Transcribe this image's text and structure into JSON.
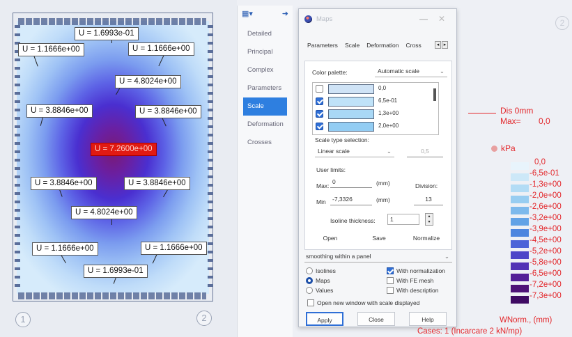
{
  "viewport": {
    "labels": [
      {
        "text": "U = 1.6993e-01"
      },
      {
        "text": "U = 1.1666e+00"
      },
      {
        "text": "U = 1.1666e+00"
      },
      {
        "text": "U = 4.8024e+00"
      },
      {
        "text": "U = 3.8846e+00"
      },
      {
        "text": "U = 3.8846e+00"
      },
      {
        "text": "U = 7.2600e+00"
      },
      {
        "text": "U = 3.8846e+00"
      },
      {
        "text": "U = 3.8846e+00"
      },
      {
        "text": "U = 4.8024e+00"
      },
      {
        "text": "U = 1.1666e+00"
      },
      {
        "text": "U = 1.1666e+00"
      },
      {
        "text": "U = 1.6993e-01"
      }
    ],
    "node_1": "1",
    "node_2": "2",
    "corner_node": "2"
  },
  "side_panel": {
    "items": [
      "Detailed",
      "Principal",
      "Complex",
      "Parameters",
      "Scale",
      "Deformation",
      "Crosses"
    ],
    "active": "Scale"
  },
  "dialog": {
    "title": "Maps",
    "minimize": "—",
    "close": "✕",
    "tabs": [
      "Parameters",
      "Scale",
      "Deformation",
      "Cross"
    ],
    "active_tab": "Scale",
    "color_palette_label": "Color palette:",
    "color_palette_value": "Automatic scale",
    "colors": [
      {
        "checked": false,
        "color": "#cfe3f6",
        "value": "0,0"
      },
      {
        "checked": true,
        "color": "#bfe2f8",
        "value": "6,5e-01"
      },
      {
        "checked": true,
        "color": "#a9d8f6",
        "value": "1,3e+00"
      },
      {
        "checked": true,
        "color": "#93cdf3",
        "value": "2,0e+00"
      }
    ],
    "scale_type_label": "Scale type selection:",
    "scale_type_value": "Linear scale",
    "scale_factor": "0,5",
    "user_limits_label": "User limits:",
    "max_label": "Max:",
    "max_value": "0",
    "max_unit": "(mm)",
    "min_label": "Min",
    "min_value": "-7,3326",
    "min_unit": "(mm)",
    "division_label": "Division:",
    "division_value": "13",
    "isoline_label": "Isoline thickness:",
    "isoline_value": "1",
    "open_label": "Open",
    "save_label": "Save",
    "normalize_label": "Normalize",
    "smoothing_value": "smoothing within a panel",
    "options_left": [
      {
        "label": "Isolines",
        "selected": false
      },
      {
        "label": "Maps",
        "selected": true
      },
      {
        "label": "Values",
        "selected": false
      }
    ],
    "options_right": [
      {
        "label": "With normalization",
        "checked": true
      },
      {
        "label": "With FE mesh",
        "checked": false
      },
      {
        "label": "With description",
        "checked": false
      }
    ],
    "open_new_window_label": "Open new window with scale displayed",
    "apply_label": "Apply",
    "close_label": "Close",
    "help_label": "Help"
  },
  "legend": {
    "dis_label": "Dis  0mm",
    "max_label": "Max=",
    "max_value": "0,0",
    "unit": "kPa",
    "values": [
      "0,0",
      "-6,5e-01",
      "-1,3e+00",
      "-2,0e+00",
      "-2,6e+00",
      "-3,2e+00",
      "-3,9e+00",
      "-4,5e+00",
      "-5,2e+00",
      "-5,8e+00",
      "-6,5e+00",
      "-7,2e+00",
      "-7,3e+00"
    ],
    "colors": [
      "#e8f4fc",
      "#cde8f8",
      "#b3dcf5",
      "#98cdf1",
      "#7db9ec",
      "#62a2e6",
      "#4d86df",
      "#4b63d8",
      "#4d45c8",
      "#5232b5",
      "#541f97",
      "#4e1278",
      "#3f0b63"
    ],
    "footer": "WNorm., (mm)",
    "cases": "Cases: 1 (Incarcare 2 kN/mp)"
  }
}
